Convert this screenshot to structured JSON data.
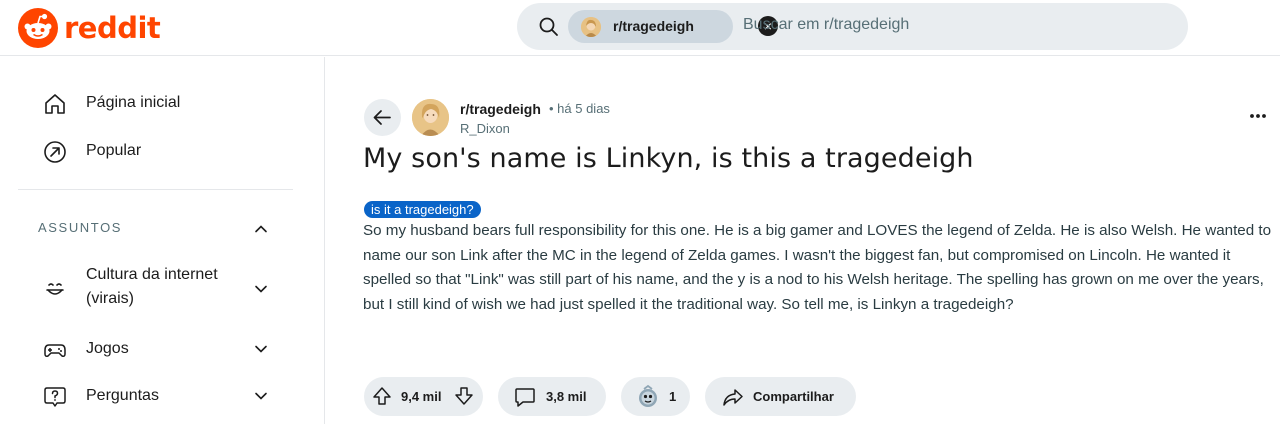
{
  "header": {
    "logo_text": "reddit",
    "search": {
      "chip_label": "r/tragedeigh",
      "placeholder": "Buscar em r/tragedeigh"
    }
  },
  "sidebar": {
    "items": [
      {
        "label": "Página inicial",
        "icon": "home-icon"
      },
      {
        "label": "Popular",
        "icon": "popular-icon"
      }
    ],
    "section_title": "ASSUNTOS",
    "topics": [
      {
        "label_line1": "Cultura da internet",
        "label_line2": "(virais)",
        "icon": "smile-icon"
      },
      {
        "label": "Jogos",
        "icon": "gamepad-icon"
      },
      {
        "label": "Perguntas",
        "icon": "question-icon"
      }
    ]
  },
  "post": {
    "subreddit": "r/tragedeigh",
    "time": "• há 5 dias",
    "author": "R_Dixon",
    "title": "My son's name is Linkyn, is this a tragedeigh",
    "flair": "is it a tragedeigh?",
    "body": "So my husband bears full responsibility for this one. He is a big gamer and LOVES the legend of Zelda. He is also Welsh. He wanted to name our son Link after the MC in the legend of Zelda games. I wasn't the biggest fan, but compromised on Lincoln. He wanted it spelled so that \"Link\" was still part of his name, and the y is a nod to his Welsh heritage. The spelling has grown on me over the years, but I still kind of wish we had just spelled it the traditional way. So tell me, is Linkyn a tragedeigh?",
    "actions": {
      "votes": "9,4 mil",
      "comments": "3,8 mil",
      "awards": "1",
      "share": "Compartilhar"
    }
  },
  "colors": {
    "brand": "#ff4500",
    "flair": "#0a64c8",
    "pill_bg": "#e9edf0"
  }
}
